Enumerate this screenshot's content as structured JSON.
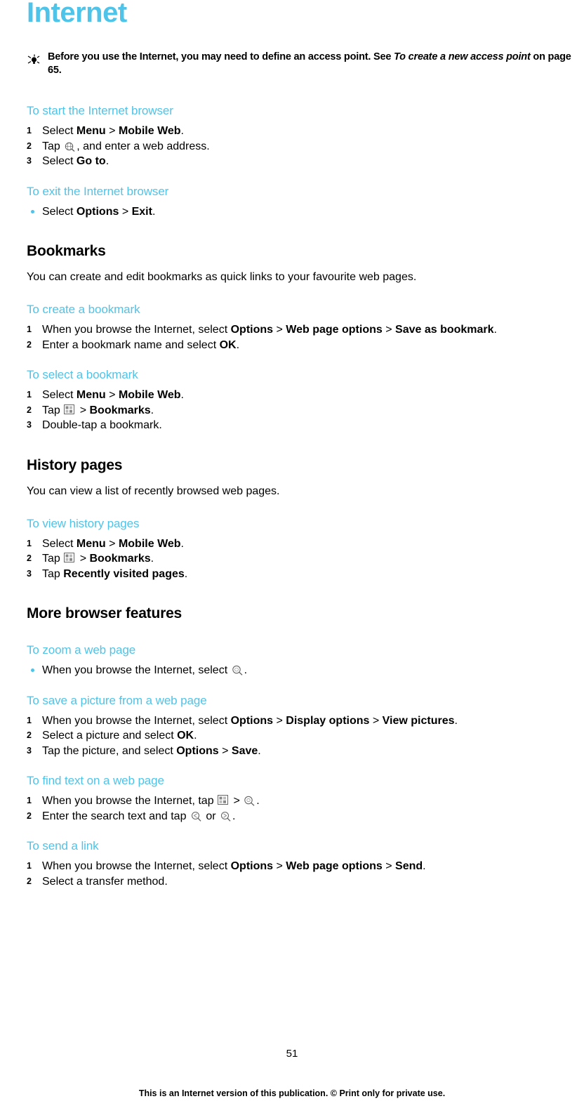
{
  "page": {
    "title": "Internet",
    "number": "51",
    "footer": "This is an Internet version of this publication. © Print only for private use."
  },
  "note": {
    "icon": "tip-bulb-icon",
    "text_1": "Before you use the Internet, you may need to define an access point. See ",
    "text_em": "To create a new access point",
    "text_2": " on page 65."
  },
  "sections": [
    {
      "heading": "To start the Internet browser",
      "type": "sub",
      "steps": [
        {
          "num": "1",
          "parts": [
            {
              "t": "Select ",
              "b": false
            },
            {
              "t": "Menu",
              "b": true
            },
            {
              "t": " > ",
              "b": false
            },
            {
              "t": "Mobile Web",
              "b": true
            },
            {
              "t": ".",
              "b": false
            }
          ]
        },
        {
          "num": "2",
          "parts": [
            {
              "t": "Tap ",
              "b": false
            },
            {
              "t": "ICON:globe-pencil-icon",
              "b": false
            },
            {
              "t": ", and enter a web address.",
              "b": false
            }
          ]
        },
        {
          "num": "3",
          "parts": [
            {
              "t": "Select ",
              "b": false
            },
            {
              "t": "Go to",
              "b": true
            },
            {
              "t": ".",
              "b": false
            }
          ]
        }
      ]
    },
    {
      "heading": "To exit the Internet browser",
      "type": "sub",
      "bullets": [
        {
          "parts": [
            {
              "t": "Select ",
              "b": false
            },
            {
              "t": "Options",
              "b": true
            },
            {
              "t": " > ",
              "b": false
            },
            {
              "t": "Exit",
              "b": true
            },
            {
              "t": ".",
              "b": false
            }
          ]
        }
      ]
    },
    {
      "heading": "Bookmarks",
      "type": "main",
      "body": "You can create and edit bookmarks as quick links to your favourite web pages."
    },
    {
      "heading": "To create a bookmark",
      "type": "sub",
      "steps": [
        {
          "num": "1",
          "parts": [
            {
              "t": "When you browse the Internet, select ",
              "b": false
            },
            {
              "t": "Options",
              "b": true
            },
            {
              "t": " > ",
              "b": false
            },
            {
              "t": "Web page options",
              "b": true
            },
            {
              "t": " > ",
              "b": false
            },
            {
              "t": "Save as bookmark",
              "b": true
            },
            {
              "t": ".",
              "b": false
            }
          ]
        },
        {
          "num": "2",
          "parts": [
            {
              "t": "Enter a bookmark name and select ",
              "b": false
            },
            {
              "t": "OK",
              "b": true
            },
            {
              "t": ".",
              "b": false
            }
          ]
        }
      ]
    },
    {
      "heading": "To select a bookmark",
      "type": "sub",
      "steps": [
        {
          "num": "1",
          "parts": [
            {
              "t": "Select ",
              "b": false
            },
            {
              "t": "Menu",
              "b": true
            },
            {
              "t": " > ",
              "b": false
            },
            {
              "t": "Mobile Web",
              "b": true
            },
            {
              "t": ".",
              "b": false
            }
          ]
        },
        {
          "num": "2",
          "parts": [
            {
              "t": "Tap ",
              "b": false
            },
            {
              "t": "ICON:bookmark-grid-icon",
              "b": false
            },
            {
              "t": " > ",
              "b": false
            },
            {
              "t": "Bookmarks",
              "b": true
            },
            {
              "t": ".",
              "b": false
            }
          ]
        },
        {
          "num": "3",
          "parts": [
            {
              "t": "Double-tap a bookmark.",
              "b": false
            }
          ]
        }
      ]
    },
    {
      "heading": "History pages",
      "type": "main",
      "body": "You can view a list of recently browsed web pages."
    },
    {
      "heading": "To view history pages",
      "type": "sub",
      "steps": [
        {
          "num": "1",
          "parts": [
            {
              "t": "Select ",
              "b": false
            },
            {
              "t": "Menu",
              "b": true
            },
            {
              "t": " > ",
              "b": false
            },
            {
              "t": "Mobile Web",
              "b": true
            },
            {
              "t": ".",
              "b": false
            }
          ]
        },
        {
          "num": "2",
          "parts": [
            {
              "t": "Tap ",
              "b": false
            },
            {
              "t": "ICON:bookmark-grid-icon",
              "b": false
            },
            {
              "t": " > ",
              "b": false
            },
            {
              "t": "Bookmarks",
              "b": true
            },
            {
              "t": ".",
              "b": false
            }
          ]
        },
        {
          "num": "3",
          "parts": [
            {
              "t": "Tap ",
              "b": false
            },
            {
              "t": "Recently visited pages",
              "b": true
            },
            {
              "t": ".",
              "b": false
            }
          ]
        }
      ]
    },
    {
      "heading": "More browser features",
      "type": "main",
      "body": ""
    },
    {
      "heading": "To zoom a web page",
      "type": "sub",
      "bullets": [
        {
          "parts": [
            {
              "t": "When you browse the Internet, select ",
              "b": false
            },
            {
              "t": "ICON:zoom-icon",
              "b": false
            },
            {
              "t": ".",
              "b": false
            }
          ]
        }
      ]
    },
    {
      "heading": "To save a picture from a web page",
      "type": "sub",
      "steps": [
        {
          "num": "1",
          "parts": [
            {
              "t": "When you browse the Internet, select ",
              "b": false
            },
            {
              "t": "Options",
              "b": true
            },
            {
              "t": " > ",
              "b": false
            },
            {
              "t": "Display options",
              "b": true
            },
            {
              "t": " > ",
              "b": false
            },
            {
              "t": "View pictures",
              "b": true
            },
            {
              "t": ".",
              "b": false
            }
          ]
        },
        {
          "num": "2",
          "parts": [
            {
              "t": "Select a picture and select ",
              "b": false
            },
            {
              "t": "OK",
              "b": true
            },
            {
              "t": ".",
              "b": false
            }
          ]
        },
        {
          "num": "3",
          "parts": [
            {
              "t": "Tap the picture, and select ",
              "b": false
            },
            {
              "t": "Options",
              "b": true
            },
            {
              "t": " > ",
              "b": false
            },
            {
              "t": "Save",
              "b": true
            },
            {
              "t": ".",
              "b": false
            }
          ]
        }
      ]
    },
    {
      "heading": "To find text on a web page",
      "type": "sub",
      "steps": [
        {
          "num": "1",
          "parts": [
            {
              "t": "When you browse the Internet, tap ",
              "b": false
            },
            {
              "t": "ICON:bookmark-grid-icon",
              "b": false
            },
            {
              "t": " > ",
              "b": false
            },
            {
              "t": "ICON:find-icon",
              "b": false
            },
            {
              "t": ".",
              "b": false
            }
          ]
        },
        {
          "num": "2",
          "parts": [
            {
              "t": "Enter the search text and tap ",
              "b": false
            },
            {
              "t": "ICON:find-prev-icon",
              "b": false
            },
            {
              "t": " or ",
              "b": false
            },
            {
              "t": "ICON:find-next-icon",
              "b": false
            },
            {
              "t": ".",
              "b": false
            }
          ]
        }
      ]
    },
    {
      "heading": "To send a link",
      "type": "sub",
      "steps": [
        {
          "num": "1",
          "parts": [
            {
              "t": "When you browse the Internet, select ",
              "b": false
            },
            {
              "t": "Options",
              "b": true
            },
            {
              "t": " > ",
              "b": false
            },
            {
              "t": "Web page options",
              "b": true
            },
            {
              "t": " > ",
              "b": false
            },
            {
              "t": "Send",
              "b": true
            },
            {
              "t": ".",
              "b": false
            }
          ]
        },
        {
          "num": "2",
          "parts": [
            {
              "t": "Select a transfer method.",
              "b": false
            }
          ]
        }
      ]
    }
  ]
}
